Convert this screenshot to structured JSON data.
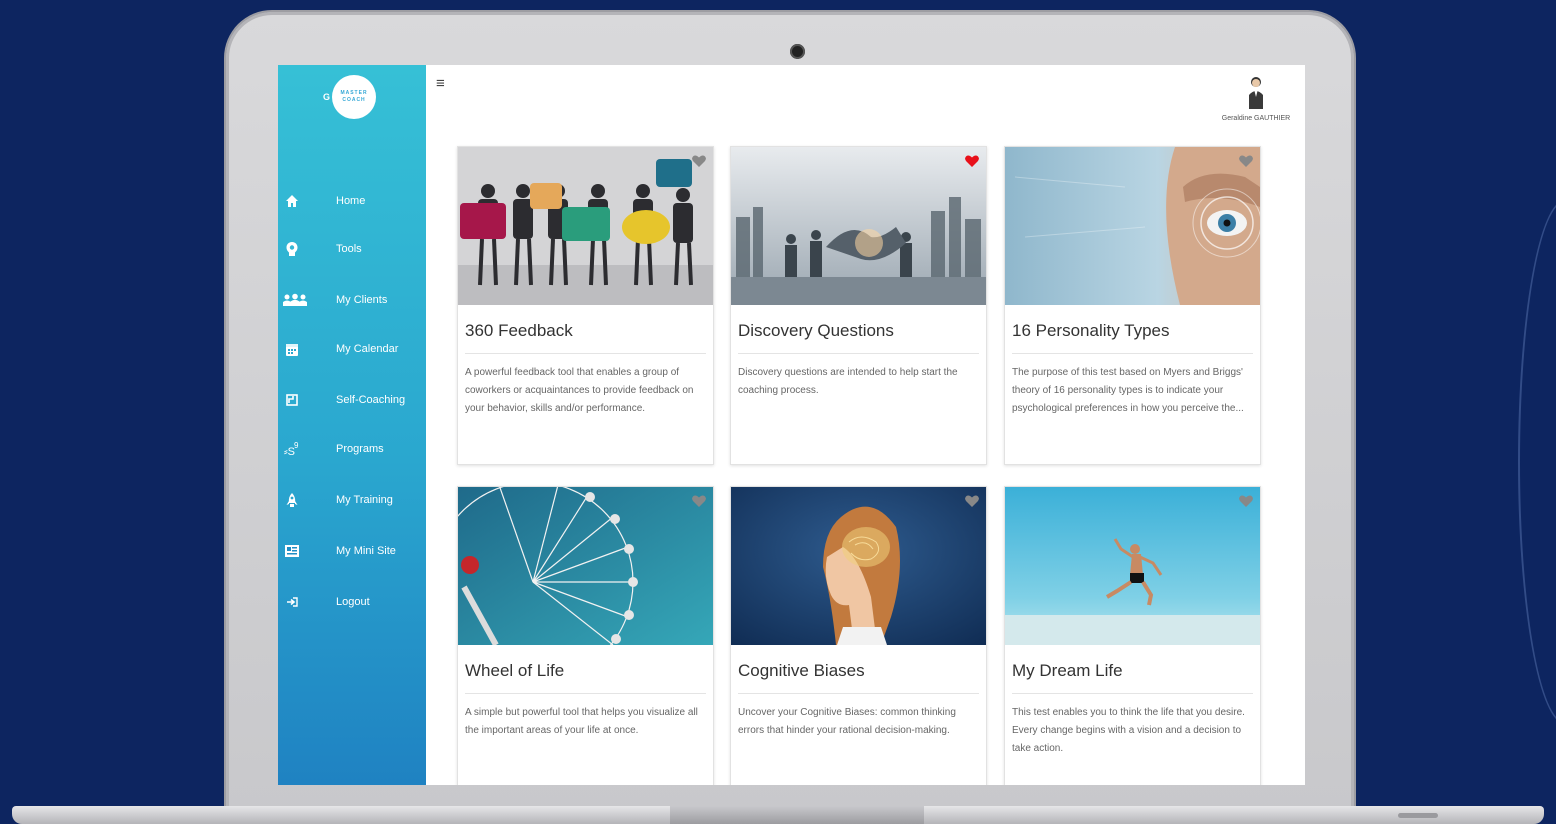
{
  "logo": {
    "prefix": "G",
    "top": "MASTER",
    "bottom": "COACH"
  },
  "sidebar": {
    "items": [
      {
        "label": "Home",
        "icon": "home-icon"
      },
      {
        "label": "Tools",
        "icon": "tools-icon"
      },
      {
        "label": "My Clients",
        "icon": "clients-icon"
      },
      {
        "label": "My Calendar",
        "icon": "calendar-icon"
      },
      {
        "label": "Self-Coaching",
        "icon": "self-coaching-icon"
      },
      {
        "label": "Programs",
        "icon": "programs-icon"
      },
      {
        "label": "My Training",
        "icon": "rocket-icon"
      },
      {
        "label": "My Mini Site",
        "icon": "mini-site-icon"
      },
      {
        "label": "Logout",
        "icon": "logout-icon"
      }
    ]
  },
  "header": {
    "menu_icon": "≡",
    "user_name": "Geraldine GAUTHIER"
  },
  "colors": {
    "sidebar_top": "#36c0d6",
    "sidebar_bottom": "#1f82c2",
    "heart_active": "#e8101a",
    "heart_inactive": "#888888"
  },
  "cards": [
    {
      "title": "360 Feedback",
      "description": "A powerful feedback tool that enables a group of coworkers or acquaintances to provide feedback on your behavior, skills and/or performance.",
      "favorite": false
    },
    {
      "title": "Discovery Questions",
      "description": "Discovery questions are intended to help start the coaching process.",
      "favorite": true
    },
    {
      "title": "16 Personality Types",
      "description": "The purpose of this test based on Myers and Briggs' theory of 16 personality types is to indicate your psychological preferences in how you perceive the...",
      "favorite": false
    },
    {
      "title": "Wheel of Life",
      "description": "A simple but powerful tool that helps you visualize all the important areas of your life at once.",
      "favorite": false
    },
    {
      "title": "Cognitive Biases",
      "description": "Uncover your Cognitive Biases: common thinking errors that hinder your rational decision-making.",
      "favorite": false
    },
    {
      "title": "My Dream Life",
      "description": "This test enables you to think the life that you desire. Every change begins with a vision and a decision to take action.",
      "favorite": false
    }
  ]
}
